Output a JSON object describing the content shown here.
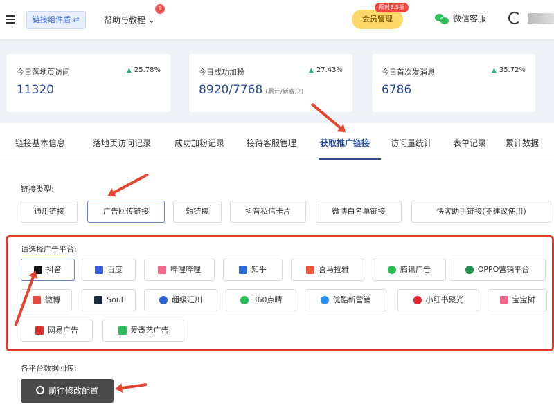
{
  "header": {
    "link_tag": "链接组件盾 ⇄",
    "help": "帮助与教程 ⌄",
    "help_badge": "1",
    "member": "会员管理",
    "member_flag": "限时8.5折",
    "wechat_support": "微信客服"
  },
  "stats": [
    {
      "label": "今日落地页访问",
      "trend": "25.78%",
      "value": "11320",
      "note": ""
    },
    {
      "label": "今日成功加粉",
      "trend": "27.43%",
      "value": "8920/7768",
      "note": "(累计/新客户)"
    },
    {
      "label": "今日首次发消息",
      "trend": "35.72%",
      "value": "6786",
      "note": ""
    }
  ],
  "tabs": [
    "链接基本信息",
    "落地页访问记录",
    "成功加粉记录",
    "接待客服管理",
    "获取推广链接",
    "访问量统计",
    "表单记录",
    "累计数据"
  ],
  "link_type": {
    "label": "链接类型:",
    "options": [
      "通用链接",
      "广告回传链接",
      "短链接",
      "抖音私信卡片",
      "微博白名单链接",
      "快客助手链接(不建议使用)"
    ],
    "selected": "广告回传链接"
  },
  "platform": {
    "label": "请选择广告平台:",
    "selected": "抖音",
    "options": [
      "抖音",
      "百度",
      "哔哩哔哩",
      "知乎",
      "喜马拉雅",
      "腾讯广告",
      "OPPO营销平台",
      "微博",
      "Soul",
      "超级汇川",
      "360点睛",
      "优酷新营销",
      "小红书聚光",
      "宝宝树",
      "网易广告",
      "爱奇艺广告"
    ]
  },
  "callback": {
    "label": "各平台数据回传:",
    "button": "前往修改配置"
  }
}
